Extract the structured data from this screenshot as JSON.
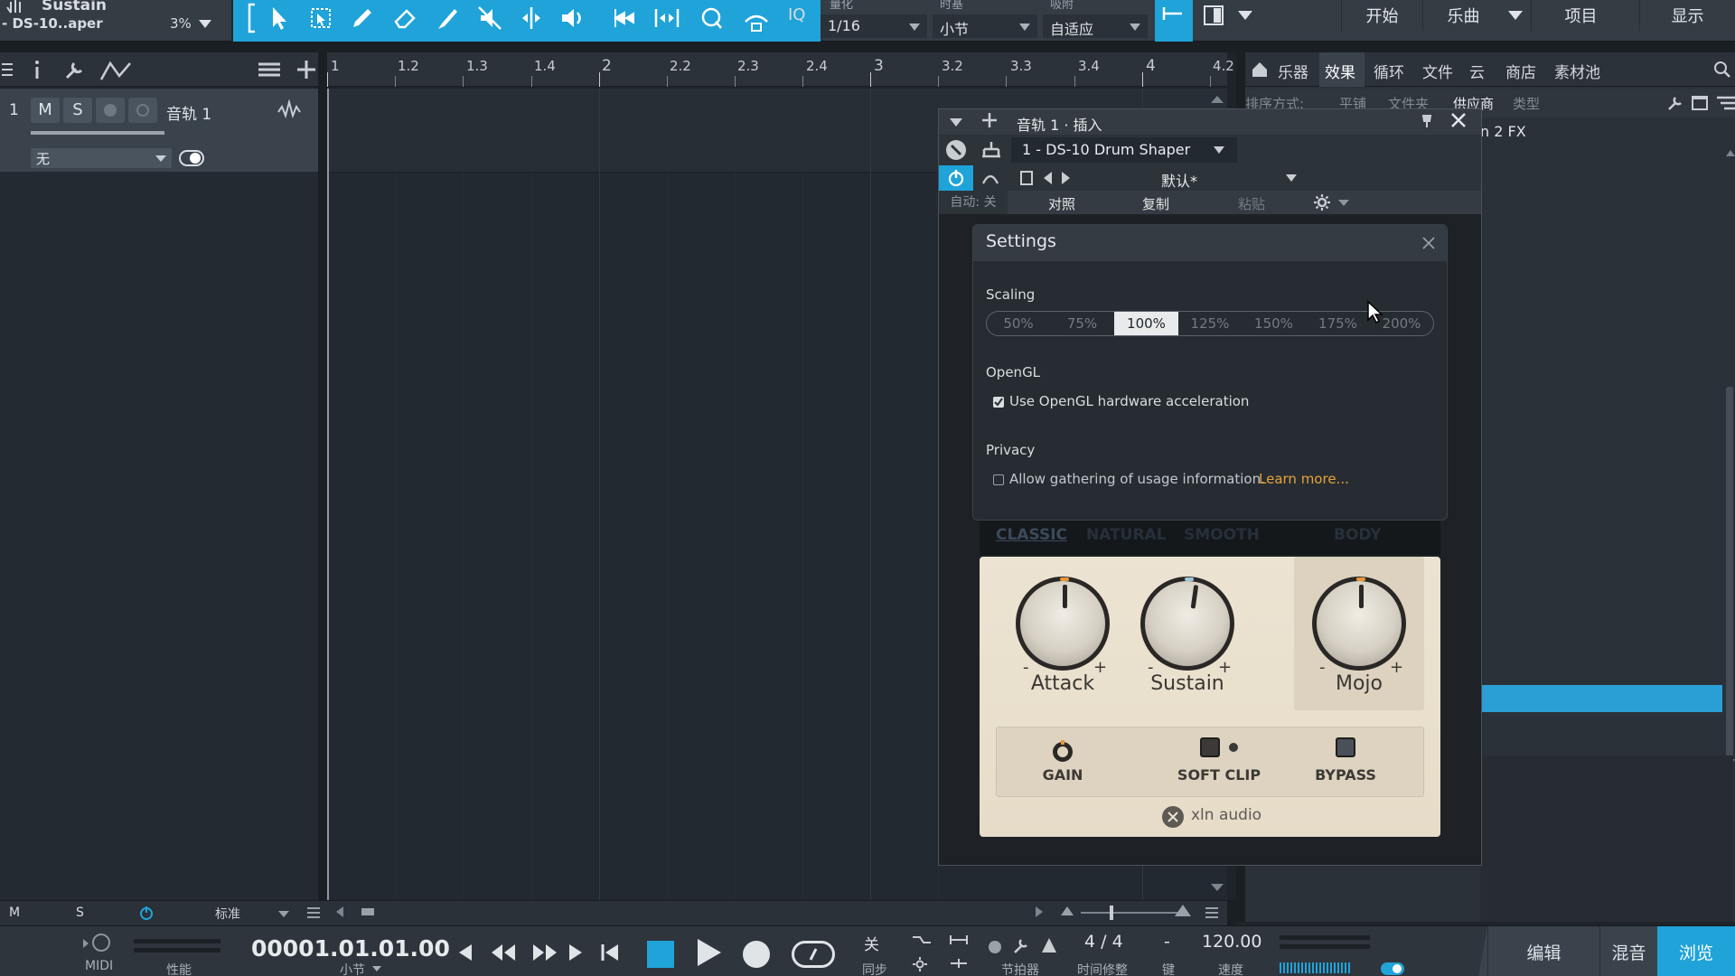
{
  "toolbar": {
    "song_name": "Sustain",
    "song_sub": "- DS-10..aper",
    "cpu_percent": "3%",
    "iq_label": "IQ",
    "quantize_label": "量化",
    "quantize_value": "1/16",
    "timebase_label": "时基",
    "timebase_value": "小节",
    "snap_label": "吸附",
    "snap_value": "自适应",
    "nav": [
      "开始",
      "乐曲",
      "项目",
      "显示"
    ]
  },
  "tracks": {
    "number": "1",
    "mute": "M",
    "solo": "S",
    "name": "音轨 1",
    "input": "无"
  },
  "ruler": {
    "ticks": [
      "1",
      "1.2",
      "1.3",
      "1.4",
      "2",
      "2.2",
      "2.3",
      "2.4",
      "3",
      "3.2",
      "3.3",
      "3.4",
      "4",
      "4.2"
    ]
  },
  "browser": {
    "tabs": [
      "乐器",
      "效果",
      "循环",
      "文件",
      "云",
      "商店",
      "素材池"
    ],
    "sort_label": "排序方式:",
    "sort_options": [
      "平铺",
      "文件夹",
      "供应商",
      "类型"
    ],
    "item_suffix": "n 2 FX"
  },
  "plugin": {
    "title": "音轨 1 · 插入",
    "slot": "1 - DS-10 Drum Shaper",
    "preset": "默认*",
    "auto_label": "自动: 关",
    "compare": "对照",
    "copy": "复制",
    "paste": "粘贴"
  },
  "settings": {
    "title": "Settings",
    "scaling_label": "Scaling",
    "scaling_options": [
      "50%",
      "75%",
      "100%",
      "125%",
      "150%",
      "175%",
      "200%"
    ],
    "scaling_selected": "100%",
    "opengl_label": "OpenGL",
    "opengl_checkbox": "Use OpenGL hardware acceleration",
    "opengl_checked": true,
    "privacy_label": "Privacy",
    "privacy_checkbox": "Allow gathering of usage information.",
    "privacy_checked": false,
    "learn_more": "Learn more..."
  },
  "device": {
    "modes": [
      "CLASSIC",
      "NATURAL",
      "SMOOTH",
      "BODY"
    ],
    "knobs": [
      "Attack",
      "Sustain",
      "Mojo"
    ],
    "minus": "-",
    "plus": "+",
    "buttons": [
      "GAIN",
      "SOFT CLIP",
      "BYPASS"
    ],
    "brand": "xln audio"
  },
  "lowbar": {
    "m": "M",
    "s": "S",
    "mode": "标准"
  },
  "transport": {
    "midi": "MIDI",
    "perf": "性能",
    "position": "00001.01.01.00",
    "position_unit": "小节",
    "sync_value": "关",
    "sync_label": "同步",
    "metronome_label": "节拍器",
    "signature": "4 / 4",
    "signature_label": "时间修整",
    "key_value": "-",
    "key_label": "键",
    "tempo": "120.00",
    "tempo_label": "速度",
    "pages": [
      "编辑",
      "混音",
      "浏览"
    ]
  },
  "colors": {
    "accent": "#1fa3d9",
    "learn_more": "#e8a33a",
    "selected_browser": "#2a9fd6"
  }
}
